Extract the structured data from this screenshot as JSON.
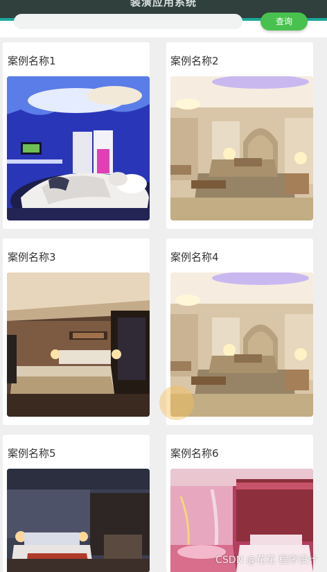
{
  "header": {
    "title": "装潢应用系统",
    "search_button": "查询"
  },
  "cases": [
    {
      "name": "案例名称1",
      "photo": "blue-hotel-bedroom-photo"
    },
    {
      "name": "案例名称2",
      "photo": "cream-hotel-bedroom-photo"
    },
    {
      "name": "案例名称3",
      "photo": "brown-hotel-bedroom-photo"
    },
    {
      "name": "案例名称4",
      "photo": "cream-hotel-bedroom-photo"
    },
    {
      "name": "案例名称5",
      "photo": "dim-hotel-bedroom-photo"
    },
    {
      "name": "案例名称6",
      "photo": "pink-hotel-bedroom-photo"
    }
  ],
  "watermark": "CSDN @花花 程序设计",
  "colors": {
    "header_bg": "#2f403d",
    "accent": "#1aa89a",
    "button": "#49c14e"
  }
}
